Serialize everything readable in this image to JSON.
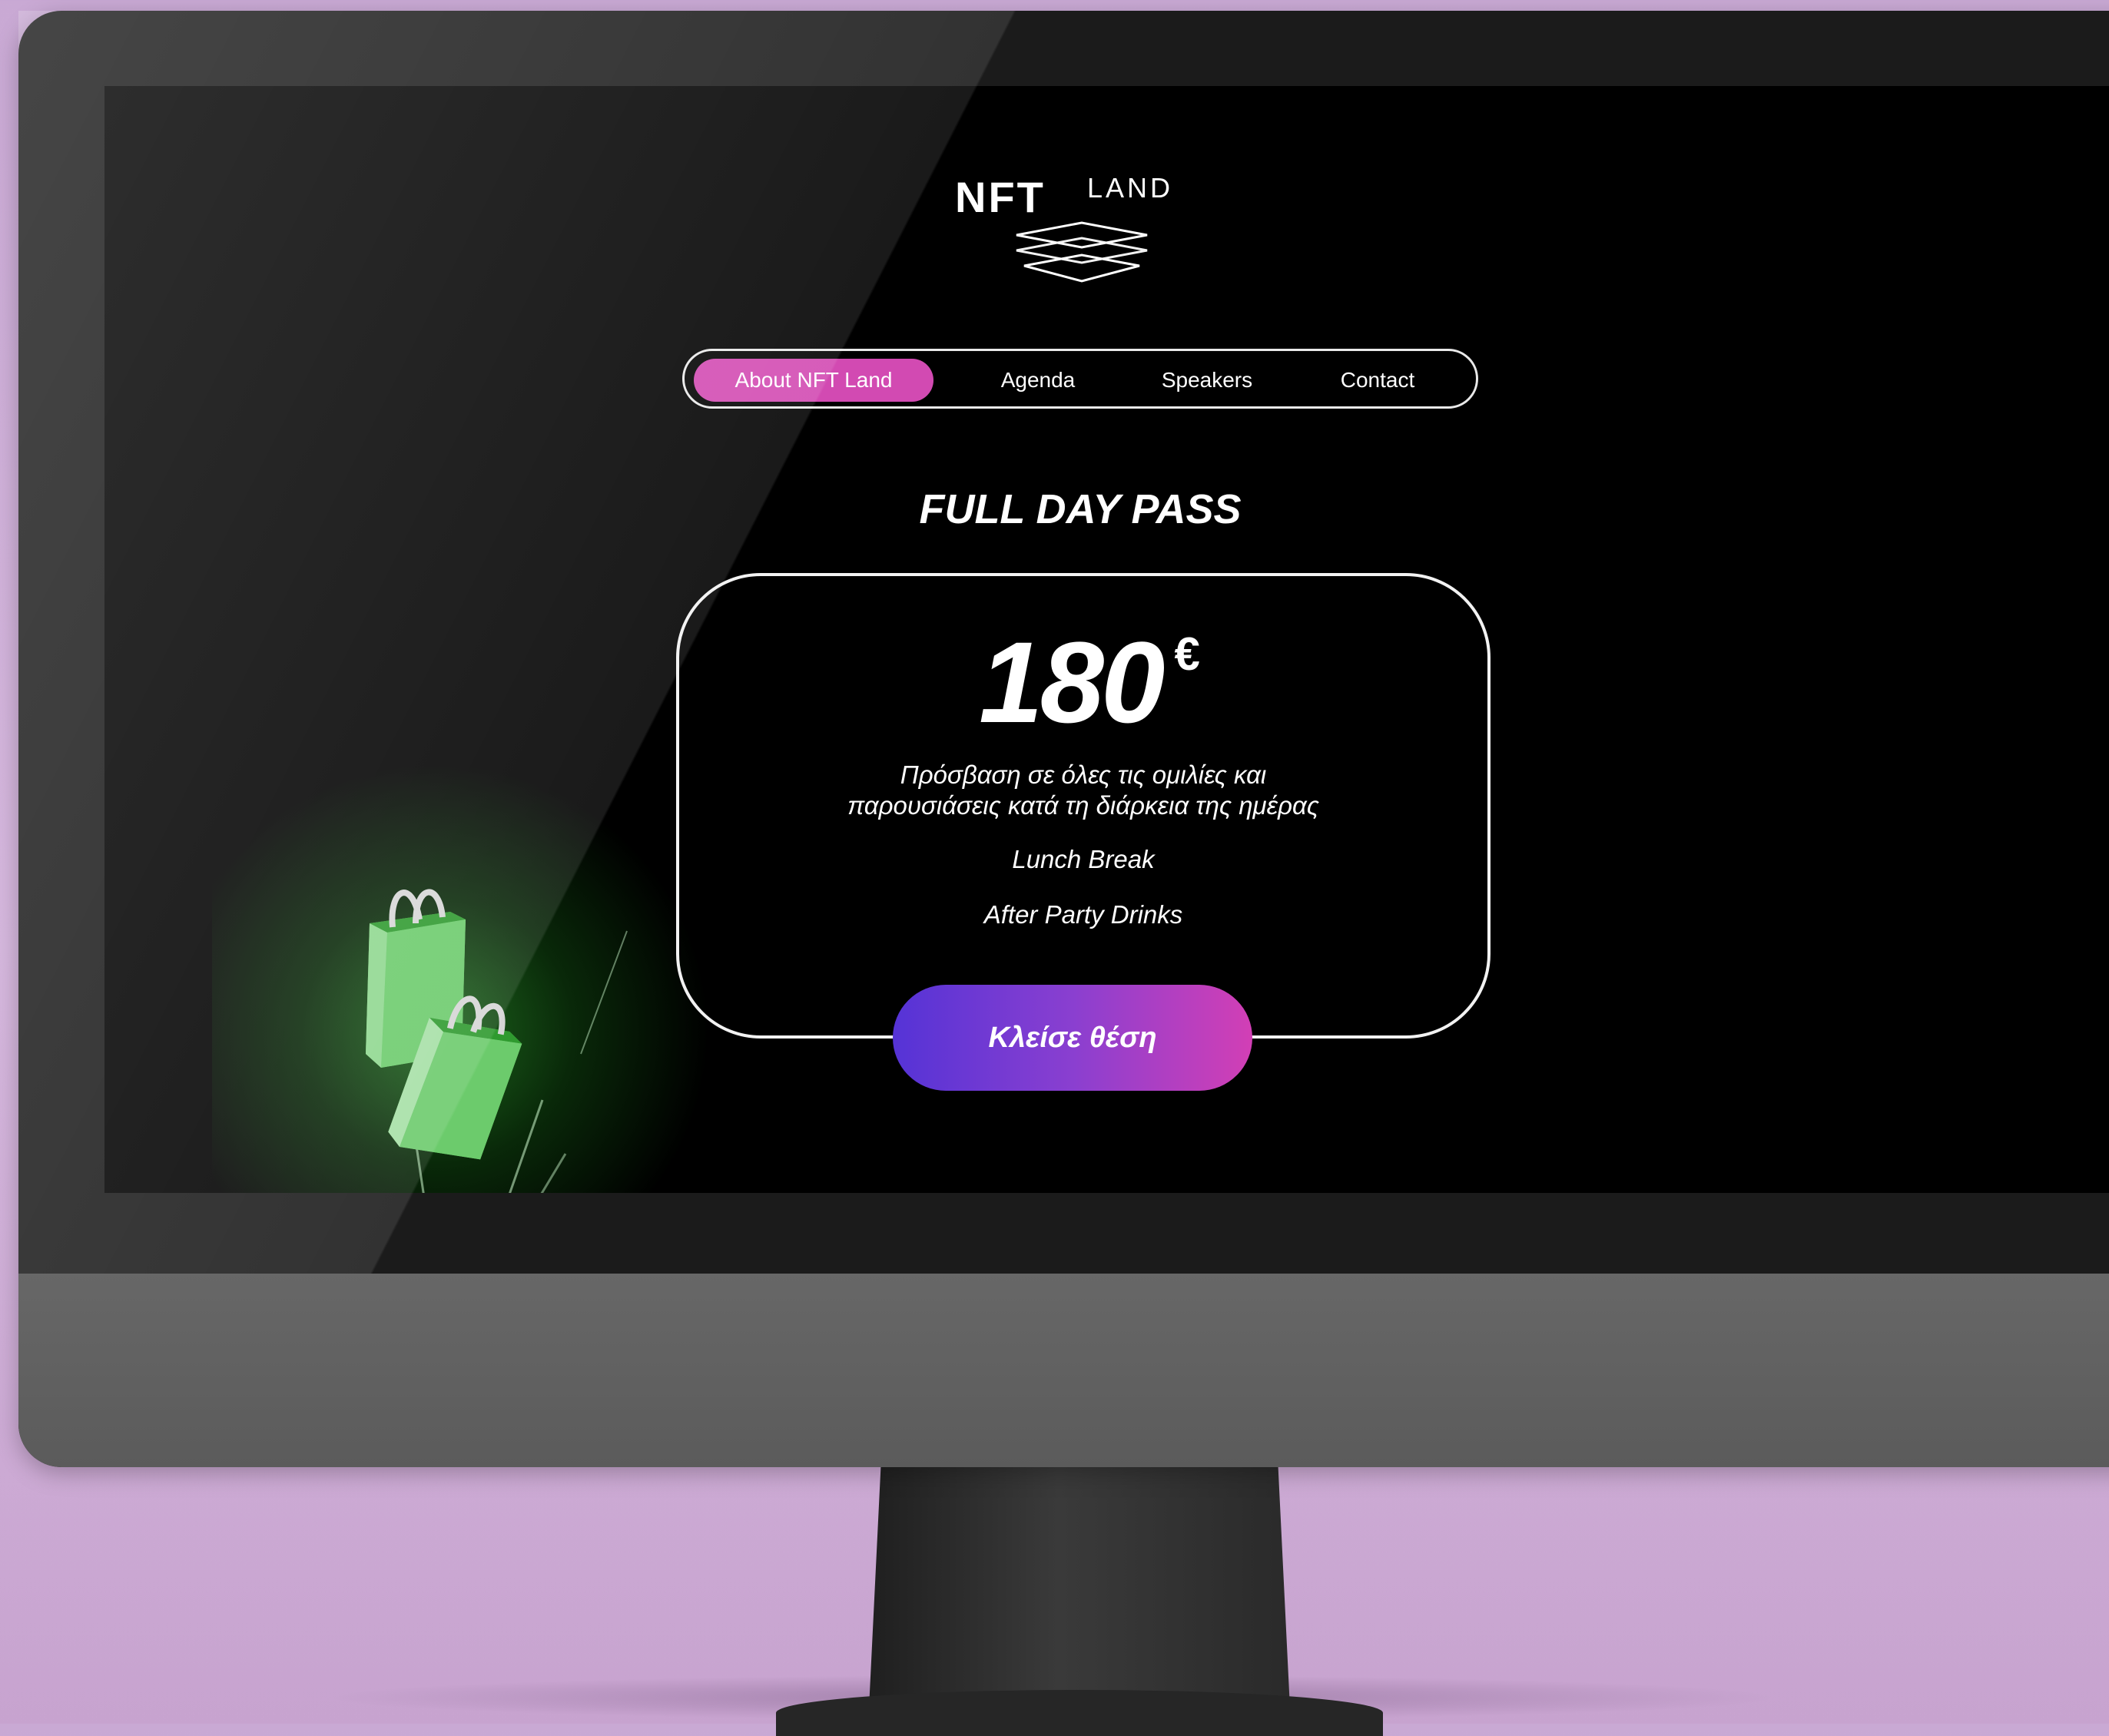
{
  "brand": {
    "name": "NFT",
    "name_sub": "LAND"
  },
  "nav": {
    "items": [
      {
        "label": "About NFT Land",
        "active": true
      },
      {
        "label": "Agenda",
        "active": false
      },
      {
        "label": "Speakers",
        "active": false
      },
      {
        "label": "Contact",
        "active": false
      }
    ]
  },
  "pass": {
    "title": "FULL DAY PASS",
    "price": "180",
    "currency": "€",
    "features": [
      "Πρόσβαση σε όλες τις ομιλίες και",
      "παρουσιάσεις κατά τη διάρκεια της ημέρας",
      "Lunch Break",
      "After Party Drinks"
    ],
    "cta_label": "Κλείσε θέση"
  },
  "colors": {
    "accent_pink": "#d24ab2",
    "cta_gradient_start": "#5533d6",
    "cta_gradient_end": "#d23fb5",
    "bag_green": "#5fbf5f"
  },
  "icons": {
    "logo_mark": "stacked-layers-icon",
    "decoration": "shopping-bags-icon"
  }
}
